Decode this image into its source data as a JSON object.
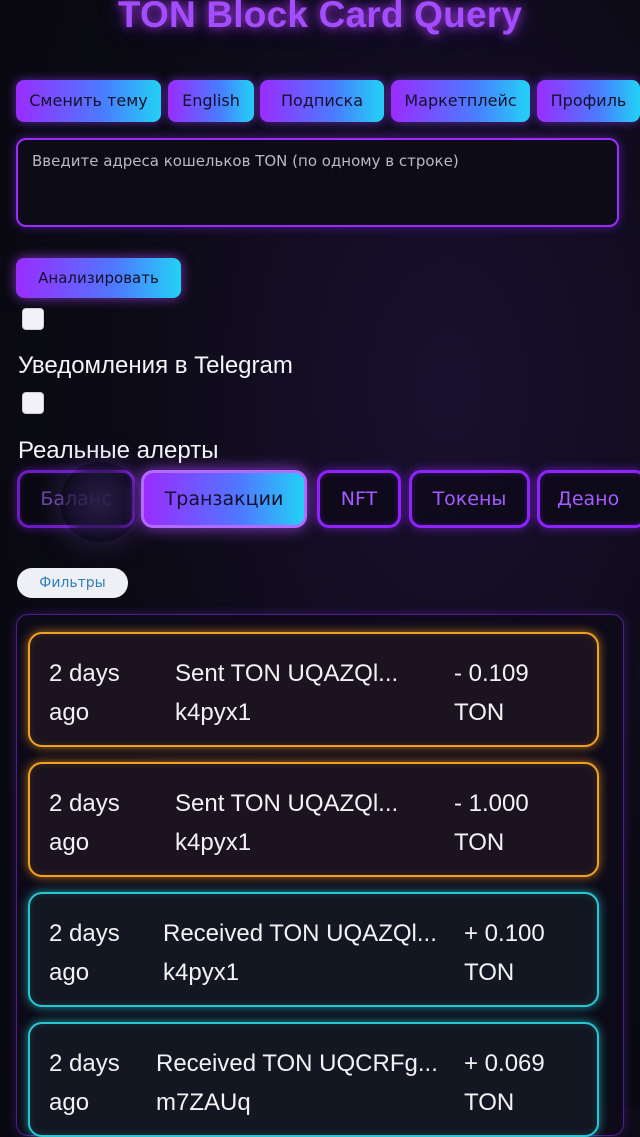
{
  "app": {
    "title": "TON Block Card Query"
  },
  "nav": {
    "buttons": [
      {
        "label": "Сменить тему"
      },
      {
        "label": "English"
      },
      {
        "label": "Подписка"
      },
      {
        "label": "Маркетплейс"
      },
      {
        "label": "Профиль"
      }
    ]
  },
  "wallet_input": {
    "value": "",
    "placeholder": "Введите адреса кошельков TON (по одному в строке)"
  },
  "analyze_button": {
    "label": "Анализировать"
  },
  "options": {
    "telegram_notifications": {
      "label": "Уведомления в Telegram",
      "checked": false
    },
    "realtime_alerts": {
      "label": "Реальные алерты",
      "checked": false
    }
  },
  "tabs": [
    {
      "label": "Баланс",
      "active": false
    },
    {
      "label": "Транзакции",
      "active": true
    },
    {
      "label": "NFT",
      "active": false
    },
    {
      "label": "Токены",
      "active": false
    },
    {
      "label": "Деано",
      "active": false
    }
  ],
  "filters_button": {
    "label": "Фильтры"
  },
  "transactions": [
    {
      "type": "sent",
      "time_line1": "2 days",
      "time_line2": "ago",
      "desc_line1": "Sent TON UQAZQl...",
      "desc_line2": "k4pyx1",
      "amount_line1": "- 0.109",
      "amount_line2": "TON"
    },
    {
      "type": "sent",
      "time_line1": "2 days",
      "time_line2": "ago",
      "desc_line1": "Sent TON UQAZQl...",
      "desc_line2": "k4pyx1",
      "amount_line1": "- 1.000",
      "amount_line2": "TON"
    },
    {
      "type": "received",
      "time_line1": "2 days",
      "time_line2": "ago",
      "desc_line1": "Received TON UQAZQl...",
      "desc_line2": "k4pyx1",
      "amount_line1": "+ 0.100",
      "amount_line2": "TON"
    },
    {
      "type": "received",
      "time_line1": "2 days",
      "time_line2": "ago",
      "desc_line1": "Received TON UQCRFg...",
      "desc_line2": "m7ZAUq",
      "amount_line1": "+ 0.069",
      "amount_line2": "TON"
    }
  ],
  "colors": {
    "accent_purple": "#9a2cff",
    "accent_cyan": "#22d2f5",
    "sent_border": "#f0a21e",
    "received_border": "#27c7d2",
    "background": "#0b0a14"
  }
}
